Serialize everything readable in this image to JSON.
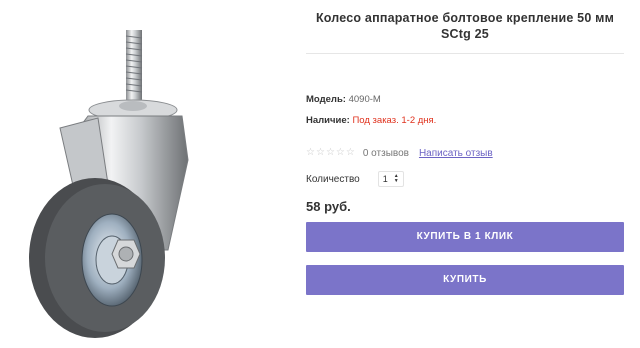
{
  "product": {
    "title": "Колесо аппаратное болтовое крепление 50 мм SCtg 25",
    "model_label": "Модель:",
    "model_value": "4090-M",
    "availability_label": "Наличие:",
    "availability_value": "Под заказ. 1-2 дня.",
    "reviews_count": "0 отзывов",
    "write_review": "Написать отзыв",
    "quantity_label": "Количество",
    "quantity_value": "1",
    "price": "58 руб.",
    "buy_one_click": "КУПИТЬ В 1 КЛИК",
    "buy": "КУПИТЬ"
  },
  "rating": {
    "value": 0,
    "max": 5
  },
  "colors": {
    "accent": "#7b74c9",
    "availability": "#e0321e",
    "link": "#6c63c4"
  },
  "icons": [
    "star-icon",
    "quantity-stepper-arrows-icon"
  ]
}
